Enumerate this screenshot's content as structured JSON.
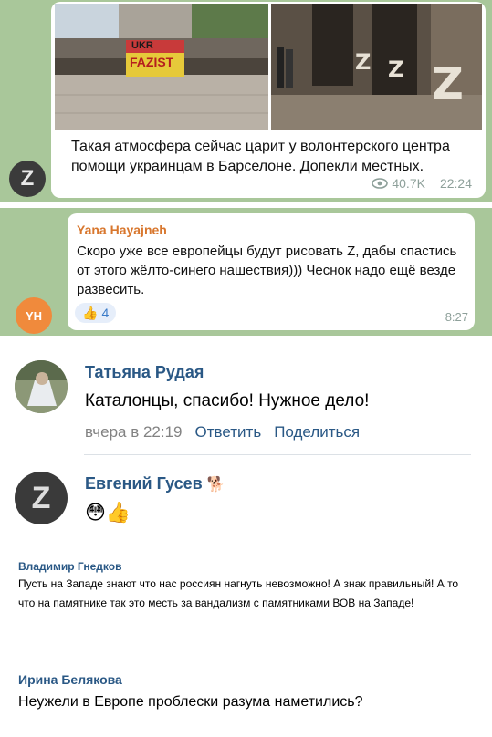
{
  "telegram_post": {
    "photo1_graffiti_lines": [
      "UKR",
      "FAZIST"
    ],
    "text": "Такая атмосфера сейчас царит у волонтерского центра помощи украинцам в Барселоне. Допекли местных.",
    "views": "40.7K",
    "time": "22:24",
    "avatar_letter": "Z"
  },
  "telegram_comment": {
    "sender": "Yana Hayajneh",
    "text": "Скоро уже все европейцы будут рисовать Z, дабы спастись от этого жёлто-синего нашествия))) Чеснок надо ещё везде развесить.",
    "reaction_emoji": "👍",
    "reaction_count": "4",
    "time": "8:27",
    "avatar_initials": "YH"
  },
  "vk_comments": [
    {
      "name": "Татьяна Рудая",
      "text": "Каталонцы, спасибо! Нужное дело!",
      "timestamp": "вчера в 22:19",
      "reply_label": "Ответить",
      "share_label": "Поделиться"
    },
    {
      "name": "Евгений Гусев",
      "name_emoji": "🐕",
      "emojis": "😳👍",
      "avatar_letter": "Z"
    }
  ],
  "other_comments": [
    {
      "name": "Владимир Гнедков",
      "text": "Пусть на Западе знают что нас россиян нагнуть невозможно! А знак правильный! А то что на памятнике так это месть за вандализм с памятниками ВОВ на Западе!"
    },
    {
      "name": "Ирина Белякова",
      "text": "Неужели в Европе проблески разума наметились?"
    }
  ],
  "colors": {
    "telegram_bg": "#a9c79a",
    "sender_orange": "#d8772e",
    "vk_link_blue": "#2a5885",
    "meta_grey": "#8ea09a"
  }
}
